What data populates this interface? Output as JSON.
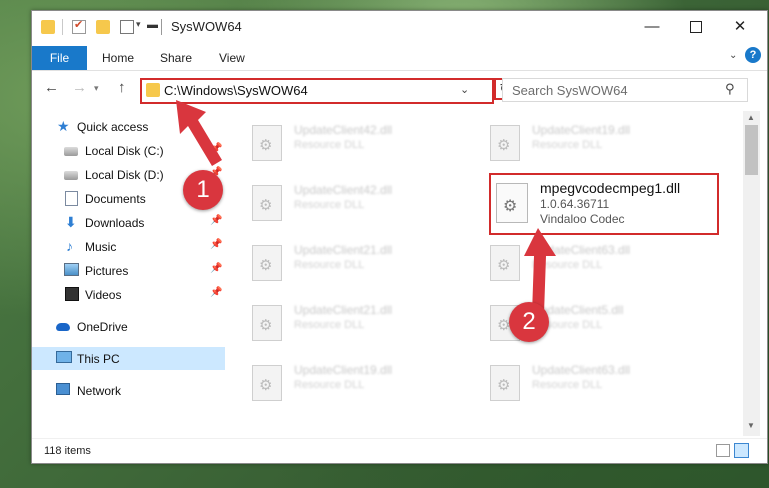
{
  "window": {
    "title": "SysWOW64"
  },
  "ribbon": {
    "tabs": [
      "File",
      "Home",
      "Share",
      "View"
    ]
  },
  "address": {
    "path": "C:\\Windows\\SysWOW64"
  },
  "search": {
    "placeholder": "Search SysWOW64"
  },
  "nav_pane": {
    "items": [
      {
        "label": "Quick access",
        "icon": "star-icon"
      },
      {
        "label": "Local Disk (C:)",
        "icon": "disk-icon",
        "pinned": true
      },
      {
        "label": "Local Disk (D:)",
        "icon": "disk-icon",
        "pinned": true
      },
      {
        "label": "Documents",
        "icon": "documents-icon",
        "pinned": true
      },
      {
        "label": "Downloads",
        "icon": "download-icon",
        "pinned": true
      },
      {
        "label": "Music",
        "icon": "music-icon",
        "pinned": true
      },
      {
        "label": "Pictures",
        "icon": "pictures-icon",
        "pinned": true
      },
      {
        "label": "Videos",
        "icon": "videos-icon",
        "pinned": true
      },
      {
        "label": "OneDrive",
        "icon": "cloud-icon"
      },
      {
        "label": "This PC",
        "icon": "computer-icon",
        "selected": true
      },
      {
        "label": "Network",
        "icon": "network-icon"
      }
    ]
  },
  "files": [
    {
      "name": "UpdateClient42.dll",
      "desc": "Resource DLL"
    },
    {
      "name": "UpdateClient19.dll",
      "desc": "Resource DLL"
    },
    {
      "name": "UpdateClient42.dll",
      "desc": "Resource DLL"
    },
    {
      "name": "UpdateClient21.dll",
      "desc": "Resource DLL"
    },
    {
      "name": "UpdateClient63.dll",
      "desc": "Resource DLL"
    },
    {
      "name": "UpdateClient21.dll",
      "desc": "Resource DLL"
    },
    {
      "name": "UpdateClient5.dll",
      "desc": "Resource DLL"
    },
    {
      "name": "UpdateClient19.dll",
      "desc": "Resource DLL"
    },
    {
      "name": "UpdateClient63.dll",
      "desc": "Resource DLL"
    }
  ],
  "highlighted_file": {
    "name": "mpegvcodecmpeg1.dll",
    "version": "1.0.64.36711",
    "description": "Vindaloo Codec"
  },
  "status": {
    "item_count": "118 items"
  },
  "annotations": {
    "step1": "1",
    "step2": "2"
  },
  "colors": {
    "accent": "#1979ca",
    "highlight": "#d22b2b",
    "badge": "#d9363e"
  }
}
